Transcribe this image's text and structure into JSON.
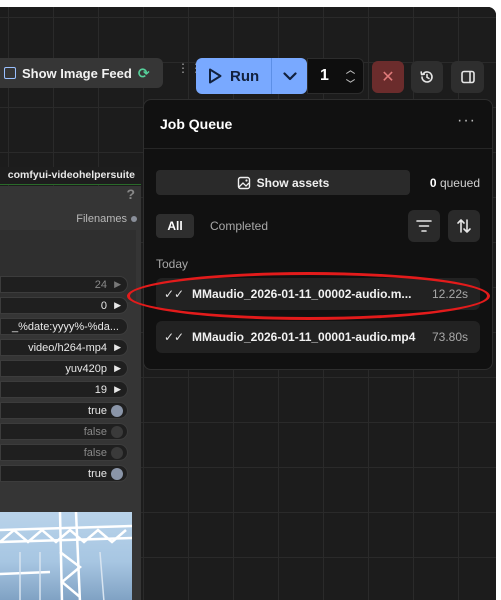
{
  "toolbar": {
    "feed_label": "Show Image Feed",
    "run_label": "Run",
    "batch_count": "1"
  },
  "node": {
    "title": "comfyui-videohelpersuite",
    "help": "?",
    "output_label": "Filenames",
    "widgets": [
      {
        "value": "24",
        "dim": true
      },
      {
        "value": "0",
        "dim": false
      },
      {
        "value": "_%date:yyyy%-%da...",
        "dim": false
      },
      {
        "value": "video/h264-mp4",
        "dim": false
      },
      {
        "value": "yuv420p",
        "dim": false
      },
      {
        "value": "19",
        "dim": false
      }
    ],
    "toggles": [
      {
        "value": "true",
        "on": true
      },
      {
        "value": "false",
        "on": false
      },
      {
        "value": "false",
        "on": false
      },
      {
        "value": "true",
        "on": true
      }
    ]
  },
  "queue": {
    "title": "Job Queue",
    "more": "···",
    "show_assets_label": "Show assets",
    "queued_count": "0",
    "queued_suffix": "queued",
    "tabs": {
      "all": "All",
      "completed": "Completed"
    },
    "group_label": "Today",
    "jobs": [
      {
        "name": "MMaudio_2026-01-11_00002-audio.m...",
        "duration": "12.22s"
      },
      {
        "name": "MMaudio_2026-01-11_00001-audio.mp4",
        "duration": "73.80s"
      }
    ]
  },
  "colors": {
    "accent": "#79a9ff",
    "stop": "#6b2c2c",
    "annotation": "#e31b1b"
  }
}
